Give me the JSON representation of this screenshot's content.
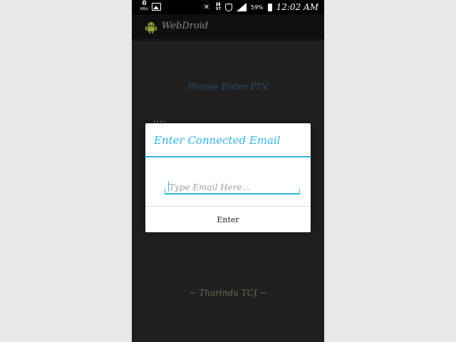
{
  "status_bar": {
    "data_speed": "0",
    "data_speed_unit": "KB/s",
    "network_type": "H",
    "network_sub": "ST",
    "battery_percent": "59%",
    "time": "12:02 AM",
    "icons": [
      "gallery-icon",
      "mute-icon",
      "shield-icon",
      "signal-icon",
      "battery-icon"
    ]
  },
  "action_bar": {
    "app_title": "WebDroid",
    "app_icon": "android-icon"
  },
  "screen": {
    "pin_prompt": "Please Enter PIN",
    "pin_dots": "••••",
    "author_credit": "~ Tharindu TCJ ~"
  },
  "dialog": {
    "title": "Enter Connected Email",
    "email_placeholder": "Type Email Here...",
    "email_value": "",
    "enter_label": "Enter"
  },
  "colors": {
    "accent": "#33b5e5",
    "background": "#1f1f1f",
    "pin_prompt": "#2c4b6c",
    "credit": "#6c6a52"
  }
}
